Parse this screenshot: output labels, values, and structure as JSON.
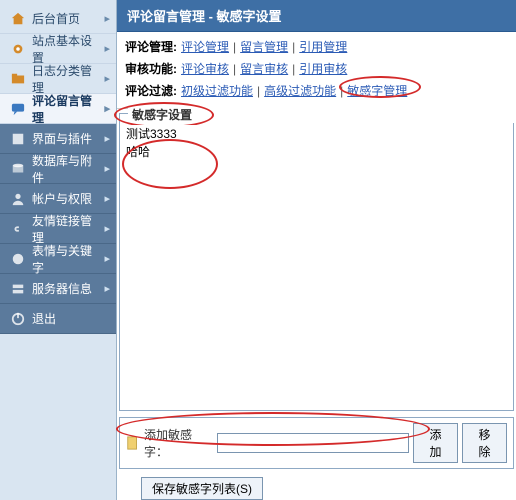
{
  "sidebar": {
    "items": [
      {
        "label": "后台首页",
        "icon": "home"
      },
      {
        "label": "站点基本设置",
        "icon": "gear"
      },
      {
        "label": "日志分类管理",
        "icon": "folder"
      },
      {
        "label": "评论留言管理",
        "icon": "comment"
      },
      {
        "label": "界面与插件",
        "icon": "plugin"
      },
      {
        "label": "数据库与附件",
        "icon": "db"
      },
      {
        "label": "帐户与权限",
        "icon": "user"
      },
      {
        "label": "友情链接管理",
        "icon": "link"
      },
      {
        "label": "表情与关键字",
        "icon": "smile"
      },
      {
        "label": "服务器信息",
        "icon": "server"
      },
      {
        "label": "退出",
        "icon": "exit"
      }
    ]
  },
  "titlebar": "评论留言管理  -  敏感字设置",
  "filterbar": {
    "rows": [
      {
        "label": "评论管理:",
        "links": [
          "评论管理",
          "留言管理",
          "引用管理"
        ]
      },
      {
        "label": "审核功能:",
        "links": [
          "评论审核",
          "留言审核",
          "引用审核"
        ]
      },
      {
        "label": "评论过滤:",
        "links": [
          "初级过滤功能",
          "高级过滤功能",
          "敏感字管理"
        ]
      }
    ],
    "separator": "|"
  },
  "fieldset": {
    "legend": "敏感字设置",
    "content": "测试3333\n哈哈"
  },
  "addbar": {
    "label": "添加敏感字：",
    "input_value": "",
    "add_btn": "添加",
    "remove_btn": "移除"
  },
  "bottom": {
    "save_btn": "保存敏感字列表(S)"
  }
}
